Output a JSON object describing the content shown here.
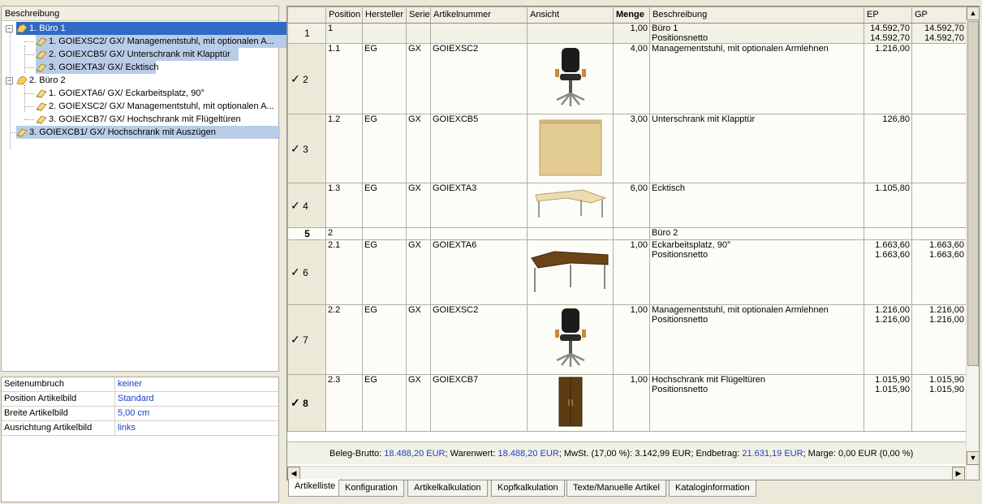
{
  "tree": {
    "header": "Beschreibung",
    "nodes": [
      {
        "label": "1. Büro 1",
        "level": 0,
        "selected": true
      },
      {
        "label": "1. GOIEXSC2/ GX/ Managementstuhl, mit optionalen A...",
        "level": 1
      },
      {
        "label": "2. GOIEXCB5/ GX/ Unterschrank mit Klapptür",
        "level": 1
      },
      {
        "label": "3. GOIEXTA3/ GX/ Ecktisch",
        "level": 1
      },
      {
        "label": "2. Büro 2",
        "level": 0
      },
      {
        "label": "1. GOIEXTA6/ GX/ Eckarbeitsplatz, 90°",
        "level": 1
      },
      {
        "label": "2. GOIEXSC2/ GX/ Managementstuhl, mit optionalen A...",
        "level": 1
      },
      {
        "label": "3. GOIEXCB7/ GX/ Hochschrank mit Flügeltüren",
        "level": 1
      },
      {
        "label": "3. GOIEXCB1/ GX/ Hochschrank mit Auszügen",
        "level": 0
      }
    ]
  },
  "properties": [
    {
      "label": "Seitenumbruch",
      "value": "keiner"
    },
    {
      "label": "Position Artikelbild",
      "value": "Standard"
    },
    {
      "label": "Breite Artikelbild",
      "value": "5,00 cm"
    },
    {
      "label": "Ausrichtung Artikelbild",
      "value": "links"
    }
  ],
  "grid": {
    "columns": [
      "",
      "Position",
      "Hersteller",
      "Serie",
      "Artikelnummer",
      "Ansicht",
      "Menge",
      "Beschreibung",
      "EP",
      "GP"
    ],
    "rows": [
      {
        "rh": "1",
        "pos": "1",
        "hersteller": "",
        "serie": "",
        "artnr": "",
        "img": "",
        "menge": "1,00",
        "desc1": "Büro 1",
        "desc2": "Positionsnetto",
        "ep1": "14.592,70",
        "ep2": "14.592,70",
        "gp1": "14.592,70",
        "gp2": "14.592,70"
      },
      {
        "rh": "2",
        "pos": "1.1",
        "hersteller": "EG",
        "serie": "GX",
        "artnr": "GOIEXSC2",
        "img": "chair",
        "menge": "4,00",
        "desc1": "Managementstuhl, mit optionalen Armlehnen",
        "desc2": "",
        "ep1": "1.216,00",
        "ep2": "",
        "gp1": "",
        "gp2": ""
      },
      {
        "rh": "3",
        "pos": "1.2",
        "hersteller": "EG",
        "serie": "GX",
        "artnr": "GOIEXCB5",
        "img": "cabinet",
        "menge": "3,00",
        "desc1": "Unterschrank mit Klapptür",
        "desc2": "",
        "ep1": "126,80",
        "ep2": "",
        "gp1": "",
        "gp2": ""
      },
      {
        "rh": "4",
        "pos": "1.3",
        "hersteller": "EG",
        "serie": "GX",
        "artnr": "GOIEXTA3",
        "img": "desk-light",
        "menge": "6,00",
        "desc1": "Ecktisch",
        "desc2": "",
        "ep1": "1.105,80",
        "ep2": "",
        "gp1": "",
        "gp2": ""
      },
      {
        "rh": "5",
        "pos": "2",
        "hersteller": "",
        "serie": "",
        "artnr": "",
        "img": "",
        "menge": "",
        "desc1": "Büro 2",
        "desc2": "",
        "ep1": "",
        "ep2": "",
        "gp1": "",
        "gp2": ""
      },
      {
        "rh": "6",
        "pos": "2.1",
        "hersteller": "EG",
        "serie": "GX",
        "artnr": "GOIEXTA6",
        "img": "desk-dark",
        "menge": "1,00",
        "desc1": "Eckarbeitsplatz, 90°",
        "desc2": "Positionsnetto",
        "ep1": "1.663,60",
        "ep2": "1.663,60",
        "gp1": "1.663,60",
        "gp2": "1.663,60"
      },
      {
        "rh": "7",
        "pos": "2.2",
        "hersteller": "EG",
        "serie": "GX",
        "artnr": "GOIEXSC2",
        "img": "chair",
        "menge": "1,00",
        "desc1": "Managementstuhl, mit optionalen Armlehnen",
        "desc2": "Positionsnetto",
        "ep1": "1.216,00",
        "ep2": "1.216,00",
        "gp1": "1.216,00",
        "gp2": "1.216,00"
      },
      {
        "rh": "8",
        "pos": "2.3",
        "hersteller": "EG",
        "serie": "GX",
        "artnr": "GOIEXCB7",
        "img": "tall-cabinet",
        "menge": "1,00",
        "desc1": "Hochschrank mit Flügeltüren",
        "desc2": "Positionsnetto",
        "ep1": "1.015,90",
        "ep2": "1.015,90",
        "gp1": "1.015,90",
        "gp2": "1.015,90"
      }
    ]
  },
  "summary": {
    "brutto_label": "Beleg-Brutto:",
    "brutto_value": "18.488,20 EUR",
    "warenwert_label": "; Warenwert:",
    "warenwert_value": "18.488,20 EUR",
    "mwst_text": "; MwSt. (17,00 %): 3.142,99 EUR; Endbetrag:",
    "endbetrag_value": "21.631,19 EUR",
    "marge_text": "; Marge: 0,00 EUR (0,00 %)"
  },
  "tabs": [
    "Artikelliste",
    "Konfiguration",
    "Artikelkalkulation",
    "Kopfkalkulation",
    "Texte/Manuelle Artikel",
    "Kataloginformation"
  ],
  "colors": {
    "selection": "#316ac5",
    "highlight": "#b9cce7",
    "link_value": "#1f3fc4"
  }
}
